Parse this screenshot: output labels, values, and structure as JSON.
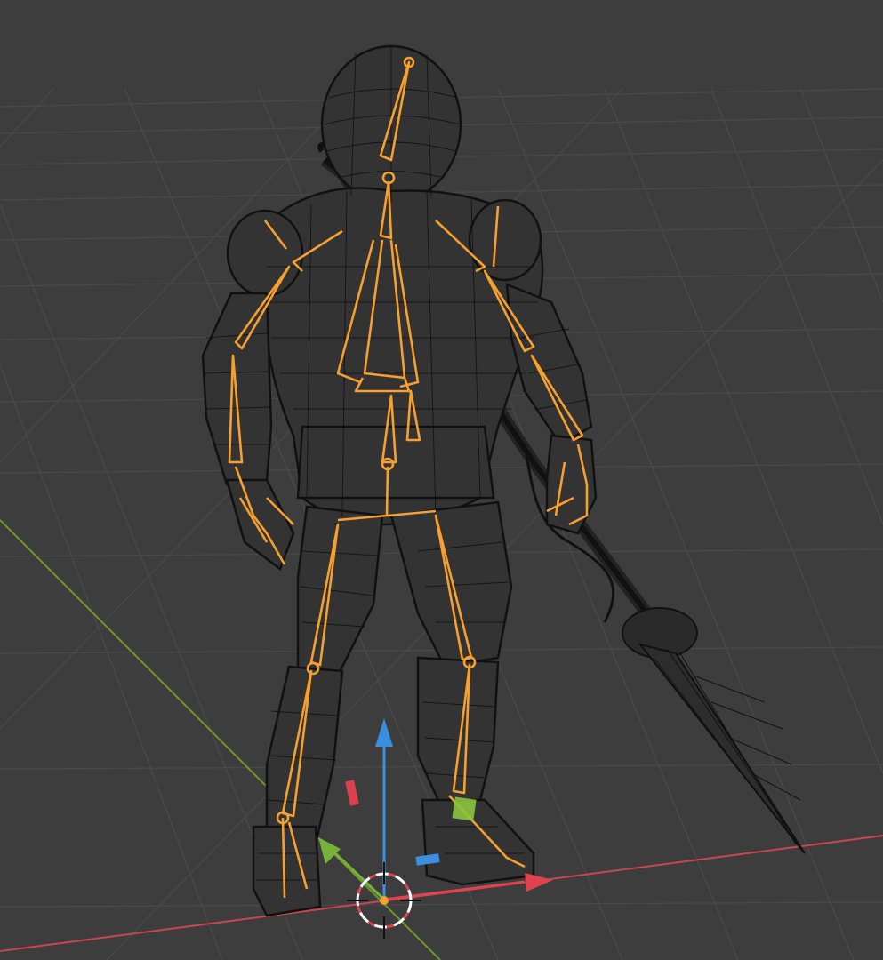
{
  "viewport": {
    "mode": "wireframe",
    "background_color": "#3d3d3d",
    "grid_color": "#4a4a4a",
    "wire_color": "#111111",
    "armature_color": "#f5a030"
  },
  "axes": {
    "x_color": "#d8414d",
    "y_color": "#6ea62d",
    "z_color": "#3b8fe0"
  },
  "objects": {
    "mesh": {
      "name_icon": "mesh-character-icon"
    },
    "armature": {
      "name_icon": "bone-icon"
    },
    "spear": {
      "name_icon": "spear-icon"
    }
  },
  "gizmo": {
    "origin_icon": "3d-cursor-icon",
    "plane_handles": [
      "xz-plane-handle",
      "yz-plane-handle",
      "xy-plane-handle"
    ]
  }
}
